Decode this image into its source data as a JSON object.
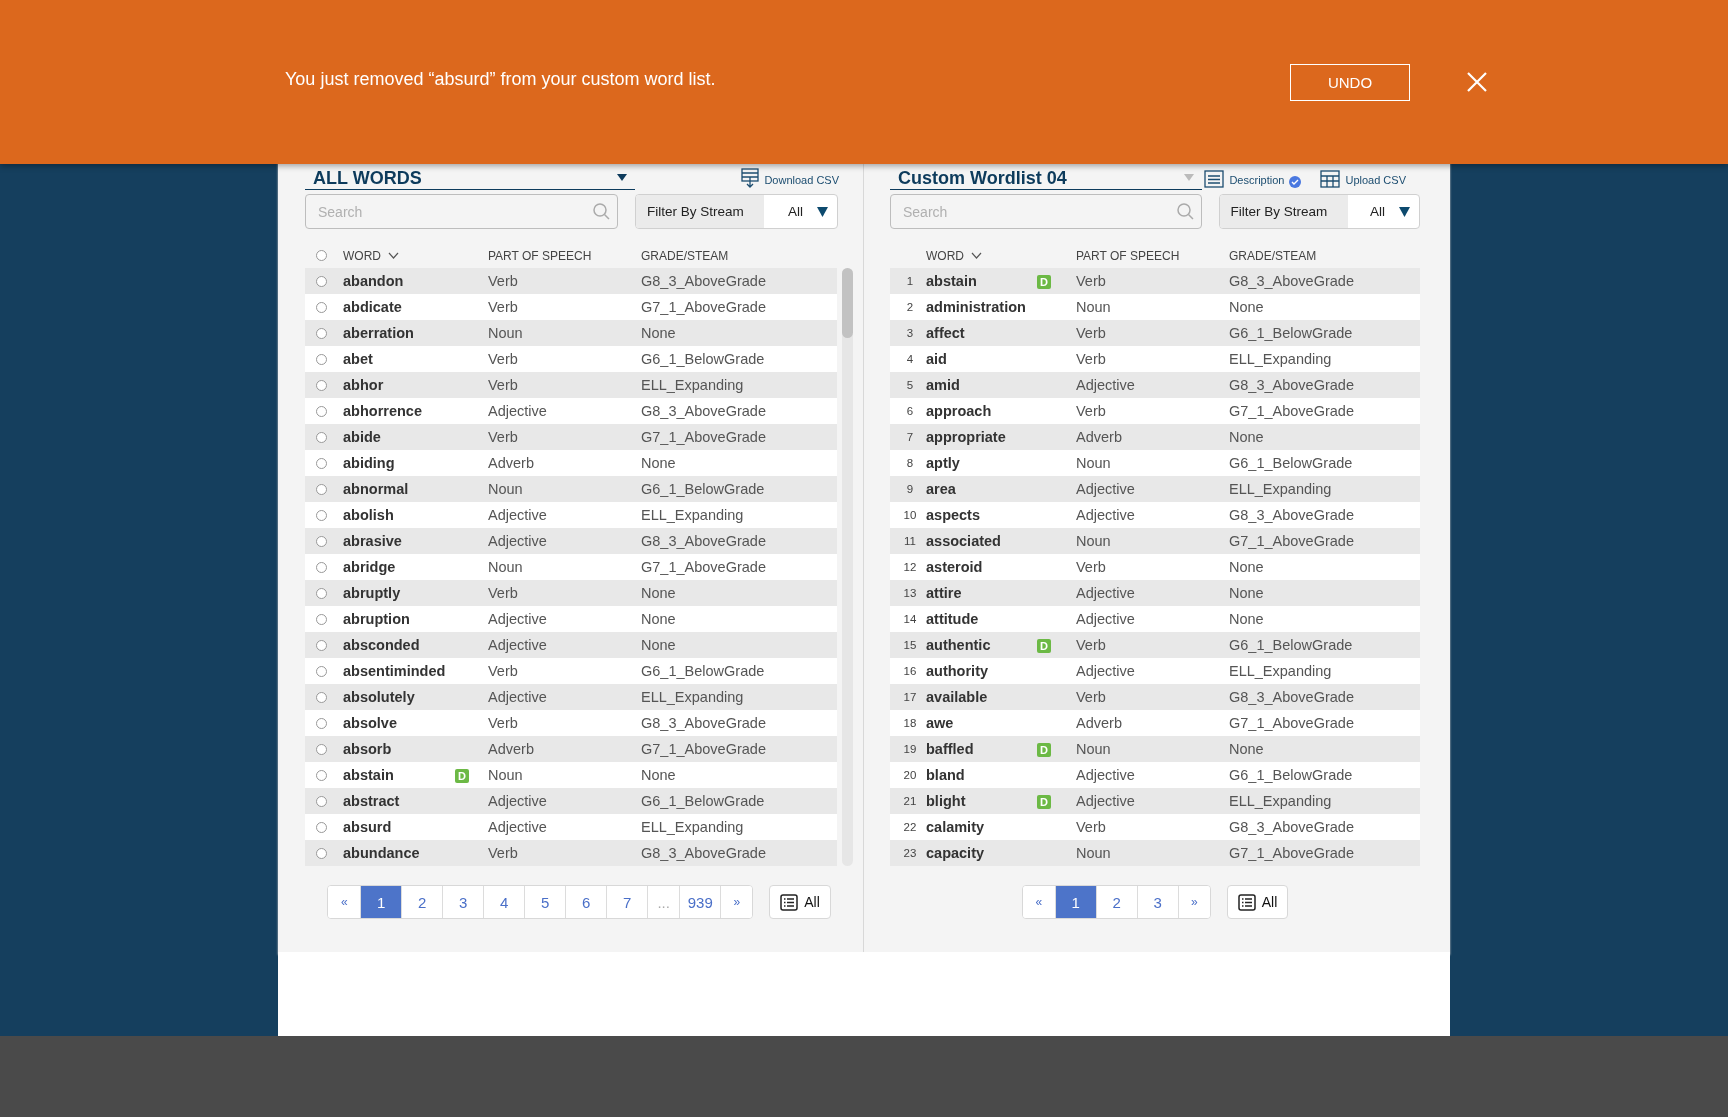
{
  "toast": {
    "message": "You just removed “absurd” from your custom word list.",
    "action": "UNDO"
  },
  "left_panel": {
    "title": "ALL WORDS",
    "download": "Download CSV",
    "search": {
      "placeholder": "Search"
    },
    "filter": {
      "label": "Filter By Stream",
      "value": "All"
    },
    "columns": [
      "WORD",
      "PART OF SPEECH",
      "GRADE/STEAM"
    ],
    "all_selected": false,
    "rows": [
      {
        "word": "abandon",
        "pos": "Verb",
        "grade": "G8_3_AboveGrade",
        "selected": false
      },
      {
        "word": "abdicate",
        "pos": "Verb",
        "grade": "G7_1_AboveGrade",
        "selected": false
      },
      {
        "word": "aberration",
        "pos": "Noun",
        "grade": "None",
        "selected": false
      },
      {
        "word": "abet",
        "pos": "Verb",
        "grade": "G6_1_BelowGrade",
        "selected": false
      },
      {
        "word": "abhor",
        "pos": "Verb",
        "grade": "ELL_Expanding",
        "selected": false
      },
      {
        "word": "abhorrence",
        "pos": "Adjective",
        "grade": "G8_3_AboveGrade",
        "selected": false
      },
      {
        "word": "abide",
        "pos": "Verb",
        "grade": "G7_1_AboveGrade",
        "selected": false
      },
      {
        "word": "abiding",
        "pos": "Adverb",
        "grade": "None",
        "selected": false
      },
      {
        "word": "abnormal",
        "pos": "Noun",
        "grade": "G6_1_BelowGrade",
        "selected": false
      },
      {
        "word": "abolish",
        "pos": "Adjective",
        "grade": "ELL_Expanding",
        "selected": false
      },
      {
        "word": "abrasive",
        "pos": "Adjective",
        "grade": "G8_3_AboveGrade",
        "selected": false
      },
      {
        "word": "abridge",
        "pos": "Noun",
        "grade": "G7_1_AboveGrade",
        "selected": false
      },
      {
        "word": "abruptly",
        "pos": "Verb",
        "grade": "None",
        "selected": false
      },
      {
        "word": "abruption",
        "pos": "Adjective",
        "grade": "None",
        "selected": false
      },
      {
        "word": "absconded",
        "pos": "Adjective",
        "grade": "None",
        "selected": false
      },
      {
        "word": "absentiminded",
        "pos": "Verb",
        "grade": "G6_1_BelowGrade",
        "selected": false
      },
      {
        "word": "absolutely",
        "pos": "Adjective",
        "grade": "ELL_Expanding",
        "selected": false
      },
      {
        "word": "absolve",
        "pos": "Verb",
        "grade": "G8_3_AboveGrade",
        "selected": false
      },
      {
        "word": "absorb",
        "pos": "Adverb",
        "grade": "G7_1_AboveGrade",
        "selected": false
      },
      {
        "word": "abstain",
        "badge": "D",
        "pos": "Noun",
        "grade": "None",
        "selected": false
      },
      {
        "word": "abstract",
        "pos": "Adjective",
        "grade": "G6_1_BelowGrade",
        "selected": false
      },
      {
        "word": "absurd",
        "pos": "Adjective",
        "grade": "ELL_Expanding",
        "selected": false
      },
      {
        "word": "abundance",
        "pos": "Verb",
        "grade": "G8_3_AboveGrade",
        "selected": false
      }
    ],
    "pages": [
      {
        "label": "«",
        "selected": false,
        "disabled": false
      },
      {
        "label": "1",
        "selected": true,
        "disabled": false
      },
      {
        "label": "2",
        "selected": false,
        "disabled": false
      },
      {
        "label": "3",
        "selected": false,
        "disabled": false
      },
      {
        "label": "4",
        "selected": false,
        "disabled": false
      },
      {
        "label": "5",
        "selected": false,
        "disabled": false
      },
      {
        "label": "6",
        "selected": false,
        "disabled": false
      },
      {
        "label": "7",
        "selected": false,
        "disabled": false
      },
      {
        "label": "...",
        "selected": false,
        "disabled": true
      },
      {
        "label": "939",
        "selected": false,
        "disabled": false
      },
      {
        "label": "»",
        "selected": false,
        "disabled": false
      }
    ],
    "all_button": "All"
  },
  "right_panel": {
    "title": "Custom Wordlist 04",
    "description": "Description",
    "upload": "Upload CSV",
    "search": {
      "placeholder": "Search"
    },
    "filter": {
      "label": "Filter By Stream",
      "value": "All"
    },
    "columns": [
      "WORD",
      "PART OF SPEECH",
      "GRADE/STEAM"
    ],
    "rows": [
      {
        "num": "1",
        "word": "abstain",
        "badge": "D",
        "pos": "Verb",
        "grade": "G8_3_AboveGrade"
      },
      {
        "num": "2",
        "word": "administration",
        "pos": "Noun",
        "grade": "None"
      },
      {
        "num": "3",
        "word": "affect",
        "pos": "Verb",
        "grade": "G6_1_BelowGrade"
      },
      {
        "num": "4",
        "word": "aid",
        "pos": "Verb",
        "grade": "ELL_Expanding"
      },
      {
        "num": "5",
        "word": "amid",
        "pos": "Adjective",
        "grade": "G8_3_AboveGrade"
      },
      {
        "num": "6",
        "word": "approach",
        "pos": "Verb",
        "grade": "G7_1_AboveGrade"
      },
      {
        "num": "7",
        "word": "appropriate",
        "pos": "Adverb",
        "grade": "None"
      },
      {
        "num": "8",
        "word": "aptly",
        "pos": "Noun",
        "grade": "G6_1_BelowGrade"
      },
      {
        "num": "9",
        "word": "area",
        "pos": "Adjective",
        "grade": "ELL_Expanding"
      },
      {
        "num": "10",
        "word": "aspects",
        "pos": "Adjective",
        "grade": "G8_3_AboveGrade"
      },
      {
        "num": "11",
        "word": "associated",
        "pos": "Noun",
        "grade": "G7_1_AboveGrade"
      },
      {
        "num": "12",
        "word": "asteroid",
        "pos": "Verb",
        "grade": "None"
      },
      {
        "num": "13",
        "word": "attire",
        "pos": "Adjective",
        "grade": "None"
      },
      {
        "num": "14",
        "word": "attitude",
        "pos": "Adjective",
        "grade": "None"
      },
      {
        "num": "15",
        "word": "authentic",
        "badge": "D",
        "pos": "Verb",
        "grade": "G6_1_BelowGrade"
      },
      {
        "num": "16",
        "word": "authority",
        "pos": "Adjective",
        "grade": "ELL_Expanding"
      },
      {
        "num": "17",
        "word": "available",
        "pos": "Verb",
        "grade": "G8_3_AboveGrade"
      },
      {
        "num": "18",
        "word": "awe",
        "pos": "Adverb",
        "grade": "G7_1_AboveGrade"
      },
      {
        "num": "19",
        "word": "baffled",
        "badge": "D",
        "pos": "Noun",
        "grade": "None"
      },
      {
        "num": "20",
        "word": "bland",
        "pos": "Adjective",
        "grade": "G6_1_BelowGrade"
      },
      {
        "num": "21",
        "word": "blight",
        "badge": "D",
        "pos": "Adjective",
        "grade": "ELL_Expanding"
      },
      {
        "num": "22",
        "word": "calamity",
        "pos": "Verb",
        "grade": "G8_3_AboveGrade"
      },
      {
        "num": "23",
        "word": "capacity",
        "pos": "Noun",
        "grade": "G7_1_AboveGrade"
      }
    ],
    "pages": [
      {
        "label": "«",
        "selected": false,
        "disabled": false
      },
      {
        "label": "1",
        "selected": true,
        "disabled": false
      },
      {
        "label": "2",
        "selected": false,
        "disabled": false
      },
      {
        "label": "3",
        "selected": false,
        "disabled": false
      },
      {
        "label": "»",
        "selected": false,
        "disabled": false
      }
    ],
    "all_button": "All"
  }
}
